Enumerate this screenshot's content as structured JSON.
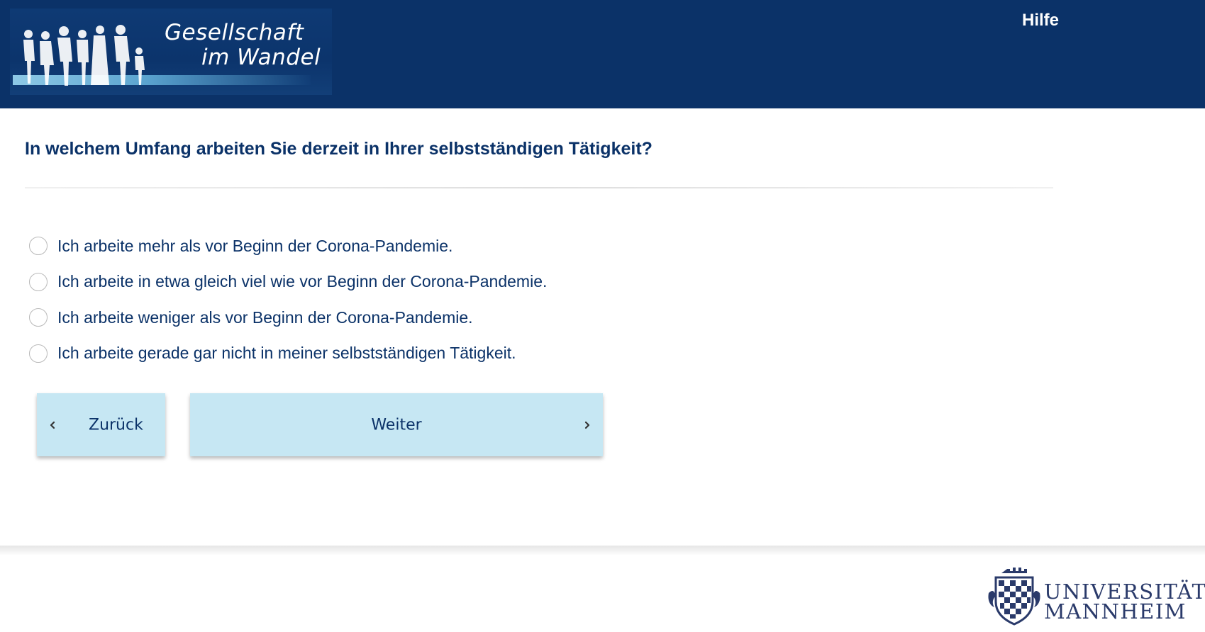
{
  "header": {
    "logo_line1": "Gesellschaft",
    "logo_line2": "im Wandel",
    "help_label": "Hilfe",
    "background_color": "#0b3268"
  },
  "question": {
    "text": "In welchem Umfang arbeiten Sie derzeit in Ihrer selbstständigen Tätigkeit?"
  },
  "options": [
    {
      "label": "Ich arbeite mehr als vor Beginn der Corona-Pandemie.",
      "selected": false
    },
    {
      "label": "Ich arbeite in etwa gleich viel wie vor Beginn der Corona-Pandemie.",
      "selected": false
    },
    {
      "label": "Ich arbeite weniger als vor Beginn der Corona-Pandemie.",
      "selected": false
    },
    {
      "label": "Ich arbeite gerade gar nicht in meiner selbstständigen Tätigkeit.",
      "selected": false
    }
  ],
  "nav": {
    "back_label": "Zurück",
    "next_label": "Weiter",
    "button_color": "#c6e7f3",
    "back_icon": "chevron-left-icon",
    "next_icon": "chevron-right-icon"
  },
  "footer": {
    "logo_line1": "UNIVERSITÄT",
    "logo_line2": "MANNHEIM",
    "logo_icon": "university-crest-icon"
  }
}
